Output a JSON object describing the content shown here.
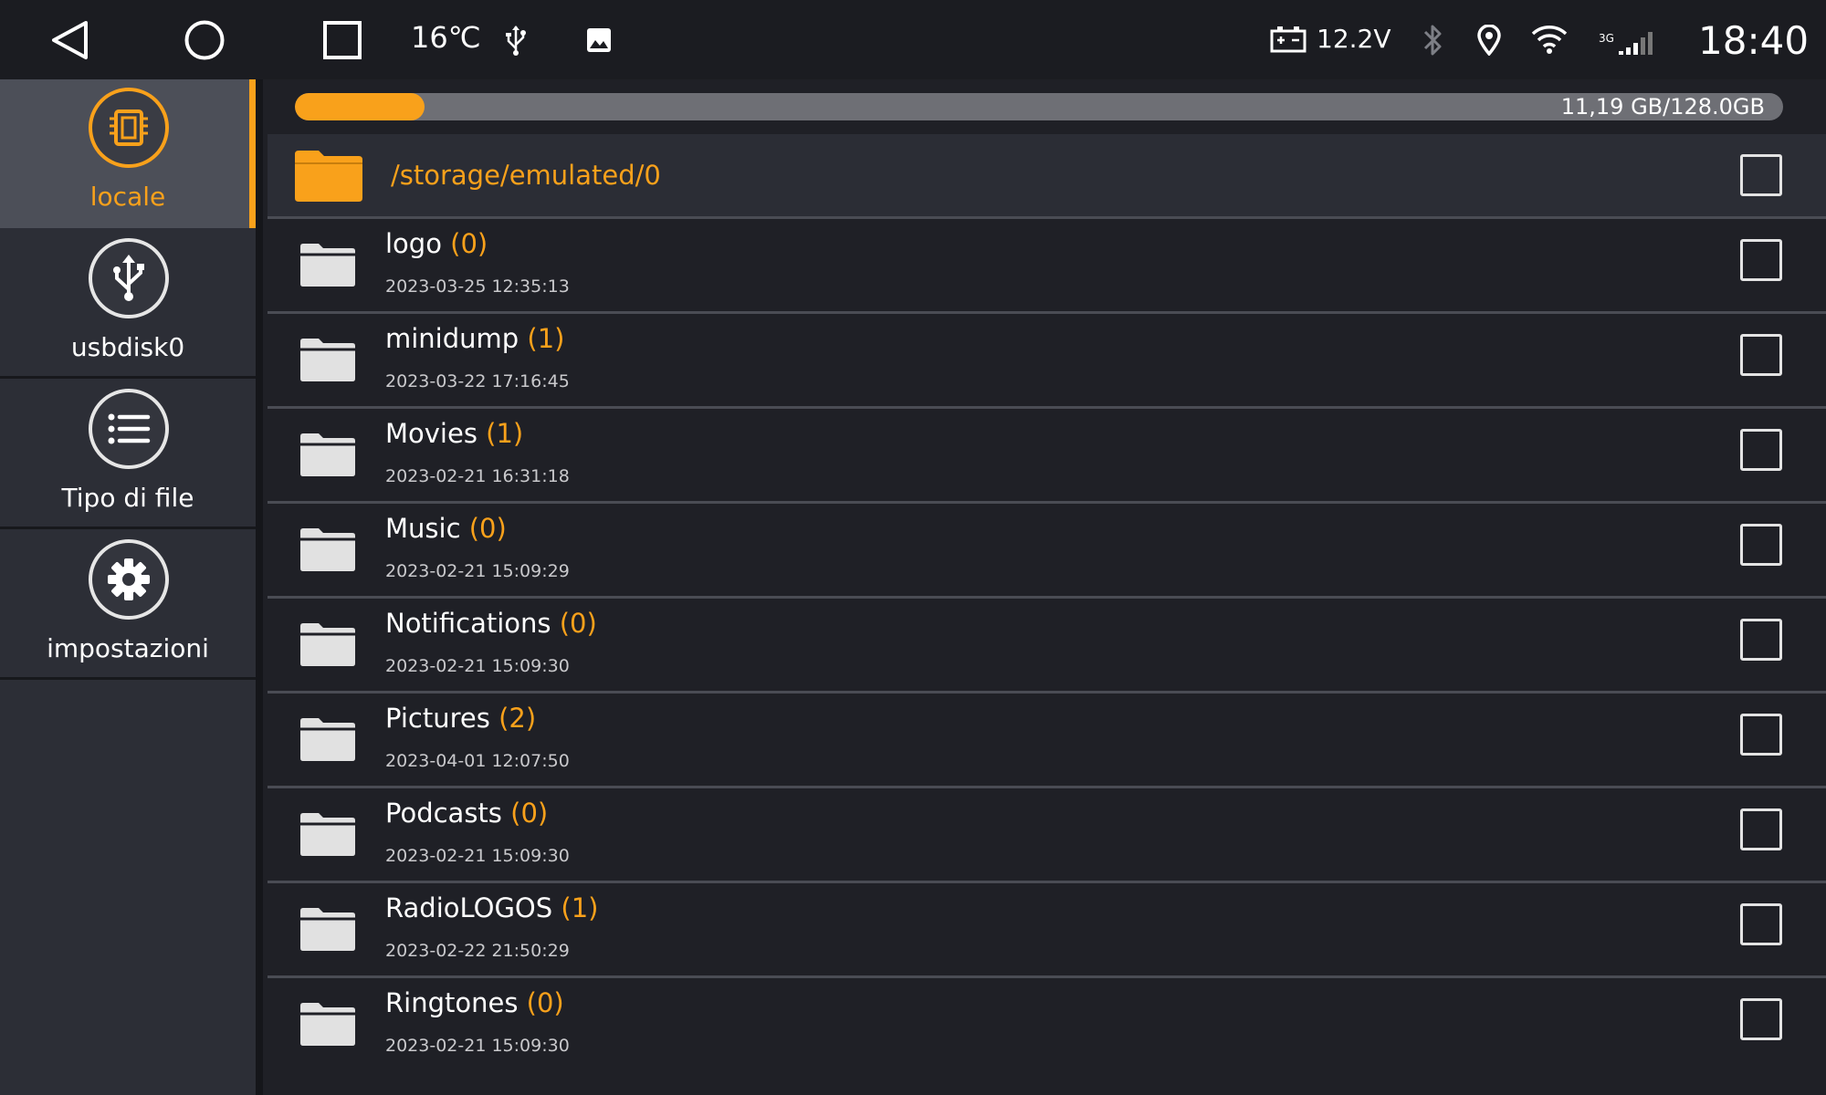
{
  "status_bar": {
    "temperature": "16℃",
    "voltage": "12.2V",
    "network_type": "3G",
    "time": "18:40",
    "icons": [
      "back-icon",
      "home-icon",
      "recents-icon",
      "usb-icon",
      "image-icon",
      "battery-icon",
      "bluetooth-icon",
      "location-icon",
      "wifi-icon",
      "signal-icon"
    ]
  },
  "sidebar": {
    "items": [
      {
        "label": "locale",
        "icon": "storage-chip-icon",
        "active": true
      },
      {
        "label": "usbdisk0",
        "icon": "usb-icon",
        "active": false
      },
      {
        "label": "Tipo di file",
        "icon": "list-icon",
        "active": false
      },
      {
        "label": "impostazioni",
        "icon": "gear-icon",
        "active": false
      }
    ]
  },
  "storage": {
    "usage_text": "11,19 GB/128.0GB",
    "used_fraction": 0.087
  },
  "current_path": "/storage/emulated/0",
  "files": [
    {
      "name": "logo",
      "count": "(0)",
      "date": "2023-03-25 12:35:13"
    },
    {
      "name": "minidump",
      "count": "(1)",
      "date": "2023-03-22 17:16:45"
    },
    {
      "name": "Movies",
      "count": "(1)",
      "date": "2023-02-21 16:31:18"
    },
    {
      "name": "Music",
      "count": "(0)",
      "date": "2023-02-21 15:09:29"
    },
    {
      "name": "Notifications",
      "count": "(0)",
      "date": "2023-02-21 15:09:30"
    },
    {
      "name": "Pictures",
      "count": "(2)",
      "date": "2023-04-01 12:07:50"
    },
    {
      "name": "Podcasts",
      "count": "(0)",
      "date": "2023-02-21 15:09:30"
    },
    {
      "name": "RadioLOGOS",
      "count": "(1)",
      "date": "2023-02-22 21:50:29"
    },
    {
      "name": "Ringtones",
      "count": "(0)",
      "date": "2023-02-21 15:09:30"
    }
  ],
  "colors": {
    "accent": "#f9a11b",
    "background": "#1f2026",
    "sidebar": "#2c2e36",
    "sidebar_active": "#4c4f58"
  }
}
